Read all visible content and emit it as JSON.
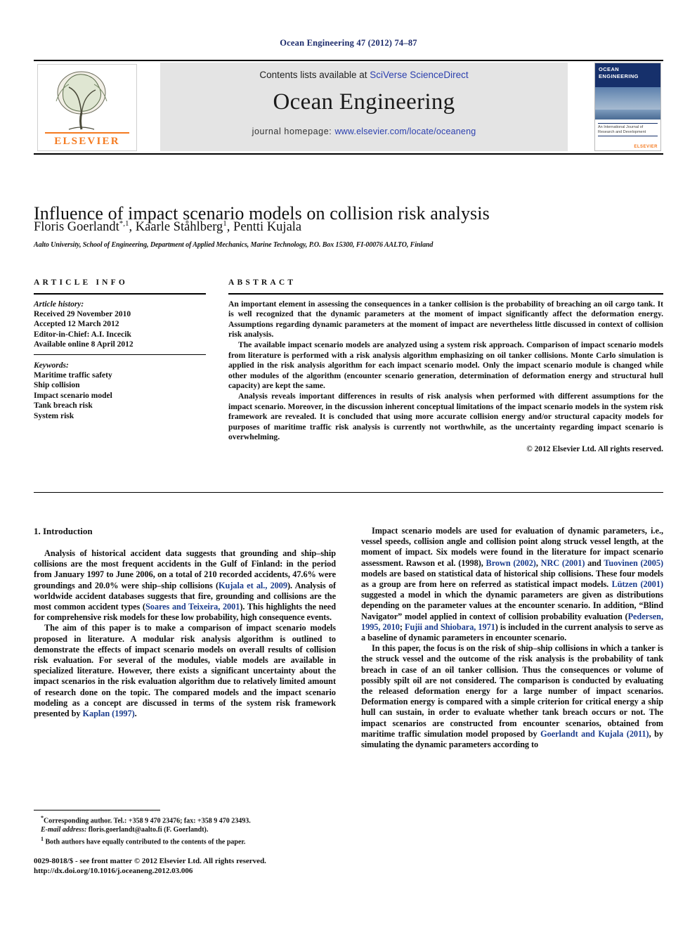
{
  "running_head": "Ocean Engineering 47 (2012) 74–87",
  "banner": {
    "contents_prefix": "Contents lists available at ",
    "contents_link": "SciVerse ScienceDirect",
    "journal_title": "Ocean Engineering",
    "homepage_prefix": "journal homepage: ",
    "homepage_url": "www.elsevier.com/locate/oceaneng",
    "publisher_logo_text": "ELSEVIER",
    "cover": {
      "line1": "OCEAN",
      "line2": "ENGINEERING",
      "caption": "An International Journal of Research and Development",
      "publisher": "ELSEVIER"
    }
  },
  "article": {
    "title": "Influence of impact scenario models on collision risk analysis",
    "authors": "Floris Goerlandt, Kaarle Ståhlberg, Pentti Kujala",
    "author_marks": {
      "first": "*,1",
      "second": "1"
    },
    "affiliation": "Aalto University, School of Engineering, Department of Applied Mechanics, Marine Technology, P.O. Box 15300, FI-00076 AALTO, Finland"
  },
  "article_info": {
    "heading": "ARTICLE INFO",
    "history_label": "Article history:",
    "history": [
      "Received 29 November 2010",
      "Accepted 12 March 2012",
      "Editor-in-Chief: A.I. Incecik",
      "Available online 8 April 2012"
    ],
    "keywords_label": "Keywords:",
    "keywords": [
      "Maritime traffic safety",
      "Ship collision",
      "Impact scenario model",
      "Tank breach risk",
      "System risk"
    ]
  },
  "abstract": {
    "heading": "ABSTRACT",
    "paragraphs": [
      "An important element in assessing the consequences in a tanker collision is the probability of breaching an oil cargo tank. It is well recognized that the dynamic parameters at the moment of impact significantly affect the deformation energy. Assumptions regarding dynamic parameters at the moment of impact are nevertheless little discussed in context of collision risk analysis.",
      "The available impact scenario models are analyzed using a system risk approach. Comparison of impact scenario models from literature is performed with a risk analysis algorithm emphasizing on oil tanker collisions. Monte Carlo simulation is applied in the risk analysis algorithm for each impact scenario model. Only the impact scenario module is changed while other modules of the algorithm (encounter scenario generation, determination of deformation energy and structural hull capacity) are kept the same.",
      "Analysis reveals important differences in results of risk analysis when performed with different assumptions for the impact scenario. Moreover, in the discussion inherent conceptual limitations of the impact scenario models in the system risk framework are revealed. It is concluded that using more accurate collision energy and/or structural capacity models for purposes of maritime traffic risk analysis is currently not worthwhile, as the uncertainty regarding impact scenario is overwhelming."
    ],
    "copyright": "© 2012 Elsevier Ltd. All rights reserved."
  },
  "body": {
    "section_title": "1. Introduction",
    "left_paragraphs": [
      {
        "segments": [
          {
            "t": "Analysis of historical accident data suggests that grounding and ship–ship collisions are the most frequent accidents in the Gulf of Finland: in the period from January 1997 to June 2006, on a total of 210 recorded accidents, 47.6% were groundings and 20.0% were ship–ship collisions ("
          },
          {
            "t": "Kujala et al., 2009",
            "cite": true
          },
          {
            "t": "). Analysis of worldwide accident databases suggests that fire, grounding and collisions are the most common accident types ("
          },
          {
            "t": "Soares and Teixeira, 2001",
            "cite": true
          },
          {
            "t": "). This highlights the need for comprehensive risk models for these low probability, high consequence events."
          }
        ]
      },
      {
        "segments": [
          {
            "t": "The aim of this paper is to make a comparison of impact scenario models proposed in literature. A modular risk analysis algorithm is outlined to demonstrate the effects of impact scenario models on overall results of collision risk evaluation. For several of the modules, viable models are available in specialized literature. However, there exists a significant uncertainty about the impact scenarios in the risk evaluation algorithm due to relatively limited amount of research done on the topic. The compared models and the impact scenario modeling as a concept are discussed in terms of the system risk framework presented by "
          },
          {
            "t": "Kaplan (1997)",
            "cite": true
          },
          {
            "t": "."
          }
        ]
      }
    ],
    "right_paragraphs": [
      {
        "segments": [
          {
            "t": "Impact scenario models are used for evaluation of dynamic parameters, i.e., vessel speeds, collision angle and collision point along struck vessel length, at the moment of impact. Six models were found in the literature for impact scenario assessment. Rawson et al. (1998), "
          },
          {
            "t": "Brown (2002)",
            "cite": true
          },
          {
            "t": ", "
          },
          {
            "t": "NRC (2001)",
            "cite": true
          },
          {
            "t": " and "
          },
          {
            "t": "Tuovinen (2005)",
            "cite": true
          },
          {
            "t": " models are based on statistical data of historical ship collisions. These four models as a group are from here on referred as statistical impact models. "
          },
          {
            "t": "Lützen (2001)",
            "cite": true
          },
          {
            "t": " suggested a model in which the dynamic parameters are given as distributions depending on the parameter values at the encounter scenario. In addition, “Blind Navigator” model applied in context of collision probability evaluation ("
          },
          {
            "t": "Pedersen, 1995, 2010",
            "cite": true
          },
          {
            "t": "; "
          },
          {
            "t": "Fujii and Shiobara, 1971",
            "cite": true
          },
          {
            "t": ") is included in the current analysis to serve as a baseline of dynamic parameters in encounter scenario."
          }
        ]
      },
      {
        "segments": [
          {
            "t": "In this paper, the focus is on the risk of ship–ship collisions in which a tanker is the struck vessel and the outcome of the risk analysis is the probability of tank breach in case of an oil tanker collision. Thus the consequences or volume of possibly spilt oil are not considered. The comparison is conducted by evaluating the released deformation energy for a large number of impact scenarios. Deformation energy is compared with a simple criterion for critical energy a ship hull can sustain, in order to evaluate whether tank breach occurs or not. The impact scenarios are constructed from encounter scenarios, obtained from maritime traffic simulation model proposed by "
          },
          {
            "t": "Goerlandt and Kujala (2011)",
            "cite": true
          },
          {
            "t": ", by simulating the dynamic parameters according to"
          }
        ]
      }
    ]
  },
  "footnotes": {
    "corresponding": "Corresponding author. Tel.: +358 9 470 23476; fax: +358 9 470 23493.",
    "email_label": "E-mail address:",
    "email": "floris.goerlandt@aalto.fi (F. Goerlandt).",
    "note1": "Both authors have equally contributed to the contents of the paper.",
    "note1_mark": "1"
  },
  "imprint": {
    "issn_line": "0029-8018/$ - see front matter © 2012 Elsevier Ltd. All rights reserved.",
    "doi_line": "http://dx.doi.org/10.1016/j.oceaneng.2012.03.006"
  }
}
